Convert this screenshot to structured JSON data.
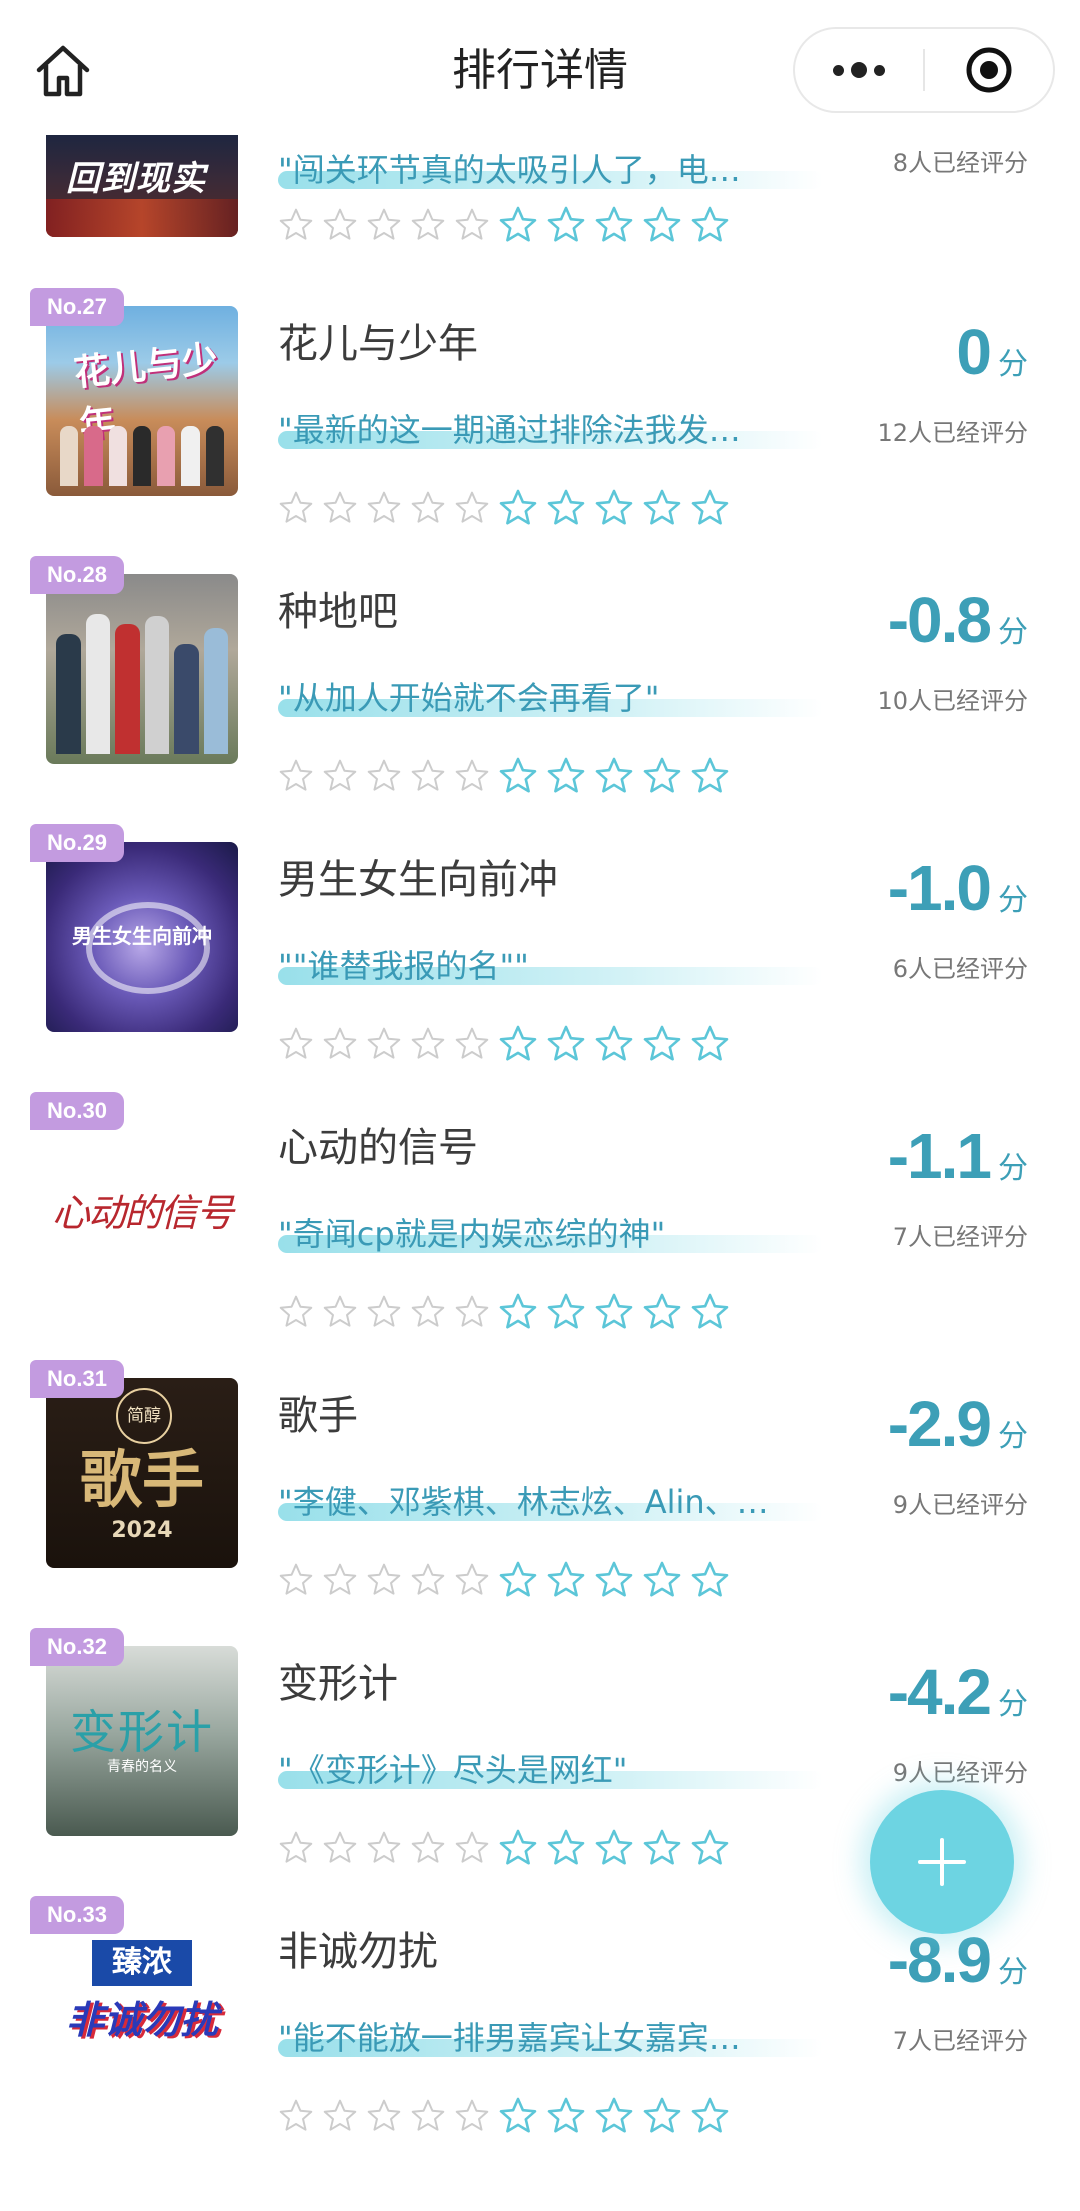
{
  "header": {
    "title": "排行详情",
    "home_icon": "home-icon",
    "more_icon": "more-dots-icon",
    "close_icon": "target-close-icon"
  },
  "colors": {
    "accent": "#3d9fb7",
    "badge": "#c39be0",
    "star_empty": "#cccccc",
    "star_teal": "#5cc6d8",
    "fab": "#6dd4e2"
  },
  "items": [
    {
      "rank": "",
      "name": "",
      "score": "",
      "unit": "",
      "quote": "\"闯关环节真的太吸引人了，电…",
      "raters": "8人已经评分",
      "thumb_text": "回到现实"
    },
    {
      "rank": "No.27",
      "name": "花儿与少年",
      "score": "0",
      "unit": "分",
      "quote": "\"最新的这一期通过排除法我发…",
      "raters": "12人已经评分",
      "thumb_text": "花儿与少年"
    },
    {
      "rank": "No.28",
      "name": "种地吧",
      "score": "-0.8",
      "unit": "分",
      "quote": "\"从加人开始就不会再看了\"",
      "raters": "10人已经评分",
      "thumb_text": ""
    },
    {
      "rank": "No.29",
      "name": "男生女生向前冲",
      "score": "-1.0",
      "unit": "分",
      "quote": "\"\"谁替我报的名\"\"",
      "raters": "6人已经评分",
      "thumb_text": "男生女生向前冲"
    },
    {
      "rank": "No.30",
      "name": "心动的信号",
      "score": "-1.1",
      "unit": "分",
      "quote": "\"奇闻cp就是内娱恋综的神\"",
      "raters": "7人已经评分",
      "thumb_text": "心动的信号"
    },
    {
      "rank": "No.31",
      "name": "歌手",
      "score": "-2.9",
      "unit": "分",
      "quote": "\"李健、邓紫棋、林志炫、Alin、…",
      "raters": "9人已经评分",
      "thumb_text": "歌手",
      "thumb_sub": "2024",
      "thumb_top": "简醇"
    },
    {
      "rank": "No.32",
      "name": "变形计",
      "score": "-4.2",
      "unit": "分",
      "quote": "\"《变形计》尽头是网红\"",
      "raters": "9人已经评分",
      "thumb_text": "变形计",
      "thumb_sub": "青春的名义"
    },
    {
      "rank": "No.33",
      "name": "非诚勿扰",
      "score": "-8.9",
      "unit": "分",
      "quote": "\"能不能放一排男嘉宾让女嘉宾…",
      "raters": "7人已经评分",
      "thumb_text": "非诚勿扰",
      "thumb_top": "臻浓"
    }
  ],
  "fab": {
    "icon": "plus-icon"
  }
}
